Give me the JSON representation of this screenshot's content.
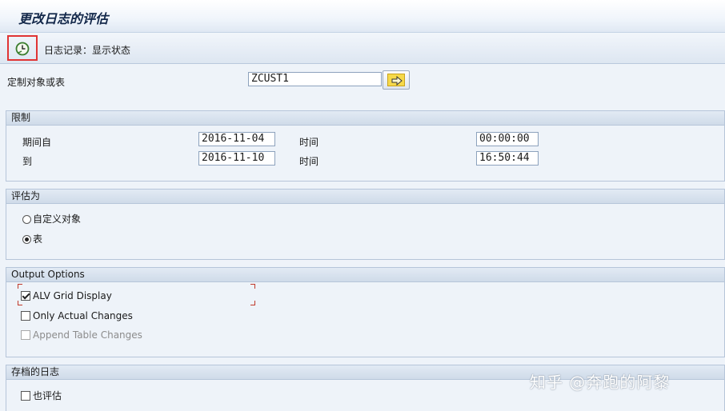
{
  "window": {
    "title": "更改日志的评估"
  },
  "toolbar": {
    "execute_label": "日志记录：显示状态"
  },
  "main": {
    "object_label": "定制对象或表",
    "object_value": "ZCUST1"
  },
  "restrictions": {
    "header": "限制",
    "period_from_label": "期间自",
    "from_date": "2016-11-04",
    "time_label": "时间",
    "from_time": "00:00:00",
    "to_label": "到",
    "to_date": "2016-11-10",
    "to_time": "16:50:44"
  },
  "evaluate_as": {
    "header": "评估为",
    "options": [
      {
        "label": "自定义对象",
        "selected": false
      },
      {
        "label": "表",
        "selected": true
      }
    ]
  },
  "output_options": {
    "header": "Output Options",
    "items": [
      {
        "label": "ALV Grid Display",
        "checked": true,
        "enabled": true
      },
      {
        "label": "Only Actual Changes",
        "checked": false,
        "enabled": true
      },
      {
        "label": "Append Table Changes",
        "checked": false,
        "enabled": false
      }
    ]
  },
  "archived_logs": {
    "header": "存档的日志",
    "also_evaluate_label": "也评估",
    "checked": false
  },
  "watermark": "知乎 @奔跑的阿黎",
  "colors": {
    "highlight": "#e03434",
    "background": "#eef3f9",
    "header": "#cfdbe9"
  },
  "icons": [
    "execute-clock-icon",
    "multiple-selection-arrow-icon"
  ]
}
